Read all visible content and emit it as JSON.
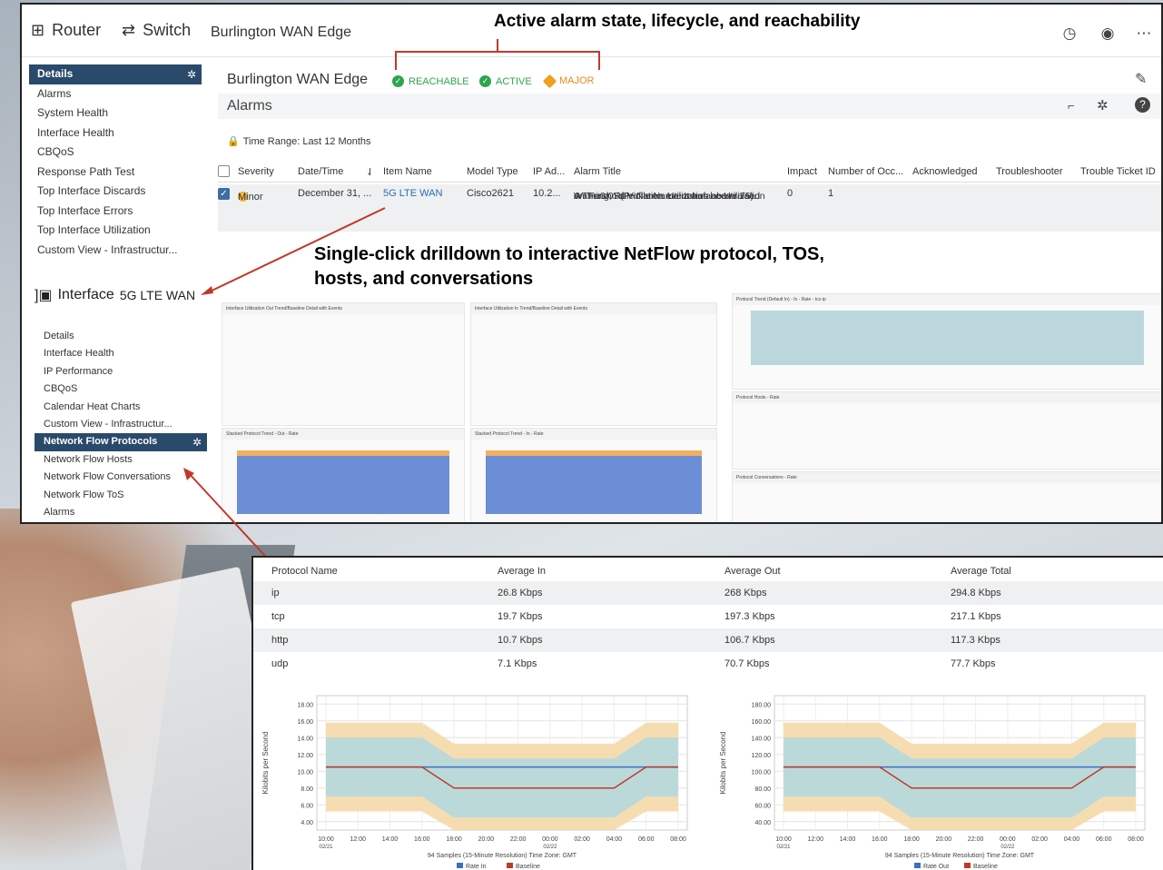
{
  "topbar": {
    "router_label": "Router",
    "switch_label": "Switch",
    "title": "Burlington WAN Edge"
  },
  "annotations": {
    "top": "Active alarm state, lifecycle, and reachability",
    "mid_line1": "Single-click drilldown to interactive NetFlow protocol, TOS,",
    "mid_line2": "hosts, and conversations"
  },
  "sidebar": {
    "items": [
      "Details",
      "Alarms",
      "System Health",
      "Interface Health",
      "CBQoS",
      "Response Path Test",
      "Top Interface Discards",
      "Top Interface Errors",
      "Top Interface Utilization",
      "Custom View - Infrastructur..."
    ]
  },
  "interface": {
    "label": "Interface",
    "name": "5G LTE WAN"
  },
  "sidebar2": {
    "items": [
      "Details",
      "Interface Health",
      "IP Performance",
      "CBQoS",
      "Calendar Heat Charts",
      "Custom View - Infrastructur...",
      "Network Flow Protocols",
      "Network Flow Hosts",
      "Network Flow Conversations",
      "Network Flow ToS",
      "Alarms"
    ]
  },
  "device": {
    "title": "Burlington WAN Edge",
    "badges": [
      {
        "label": "REACHABLE",
        "color": "#2ea44f"
      },
      {
        "label": "ACTIVE",
        "color": "#2ea44f"
      },
      {
        "label": "MAJOR",
        "color": "#e8891e"
      }
    ]
  },
  "alarms": {
    "title": "Alarms",
    "time_range": "Time Range: Last 12 Months",
    "columns": [
      "Severity",
      "Date/Time",
      "Item Name",
      "Model Type",
      "IP Ad...",
      "Alarm Title",
      "Impact",
      "Number of Occ...",
      "Acknowledged",
      "Troubleshooter",
      "Trouble Ticket ID"
    ],
    "row": {
      "severity": "Minor",
      "date": "December 31, ...",
      "item": "5G LTE WAN",
      "model": "Cisco2621",
      "ip": "10.2...",
      "title_l1": "A Threshold Violation event has been raised",
      "title_l2": "on 'Fa0/0'. (Profile Name: Interface Utilization",
      "title_l3": "Warning, Rule Name: Utilization above 75).",
      "impact": "0",
      "occ": "1"
    }
  },
  "protocols": {
    "columns": [
      "Protocol Name",
      "Average In",
      "Average Out",
      "Average Total"
    ],
    "rows": [
      [
        "ip",
        "26.8 Kbps",
        "268 Kbps",
        "294.8 Kbps"
      ],
      [
        "tcp",
        "19.7 Kbps",
        "197.3 Kbps",
        "217.1 Kbps"
      ],
      [
        "http",
        "10.7 Kbps",
        "106.7 Kbps",
        "117.3 Kbps"
      ],
      [
        "udp",
        "7.1 Kbps",
        "70.7 Kbps",
        "77.7 Kbps"
      ]
    ]
  },
  "chart_data": [
    {
      "type": "line",
      "ylabel": "Kilobits per Second",
      "xlabel": "94 Samples (15-Minute Resolution) Time Zone: GMT",
      "ylim": [
        3,
        19
      ],
      "yticks": [
        "4.00",
        "6.00",
        "8.00",
        "10.00",
        "12.00",
        "14.00",
        "16.00",
        "18.00"
      ],
      "xticks": [
        "10:00",
        "12:00",
        "14:00",
        "16:00",
        "18:00",
        "20:00",
        "22:00",
        "00:00",
        "02:00",
        "04:00",
        "06:00",
        "08:00"
      ],
      "xsub": {
        "first": "02/21",
        "mid": "02/22"
      },
      "series": [
        {
          "name": "Rate In",
          "color": "#3a6fc4",
          "values": [
            10.5,
            10.5,
            10.5,
            10.5,
            10.5,
            10.5,
            10.5,
            10.5,
            10.5,
            10.5,
            10.5,
            10.5
          ]
        },
        {
          "name": "Baseline",
          "color": "#c0392b",
          "values": [
            10.5,
            10.5,
            10.5,
            10.5,
            8.0,
            8.0,
            8.0,
            8.0,
            8.0,
            8.0,
            10.5,
            10.5
          ]
        }
      ]
    },
    {
      "type": "line",
      "ylabel": "Kilobits per Second",
      "xlabel": "94 Samples (15-Minute Resolution) Time Zone: GMT",
      "ylim": [
        30,
        190
      ],
      "yticks": [
        "40.00",
        "60.00",
        "80.00",
        "100.00",
        "120.00",
        "140.00",
        "160.00",
        "180.00"
      ],
      "xticks": [
        "10:00",
        "12:00",
        "14:00",
        "16:00",
        "18:00",
        "20:00",
        "22:00",
        "00:00",
        "02:00",
        "04:00",
        "06:00",
        "08:00"
      ],
      "xsub": {
        "first": "02/21",
        "mid": "02/22"
      },
      "series": [
        {
          "name": "Rate Out",
          "color": "#3a6fc4",
          "values": [
            105,
            105,
            105,
            105,
            105,
            105,
            105,
            105,
            105,
            105,
            105,
            105
          ]
        },
        {
          "name": "Baseline",
          "color": "#c0392b",
          "values": [
            105,
            105,
            105,
            105,
            80,
            80,
            80,
            80,
            80,
            80,
            105,
            105
          ]
        }
      ]
    }
  ]
}
